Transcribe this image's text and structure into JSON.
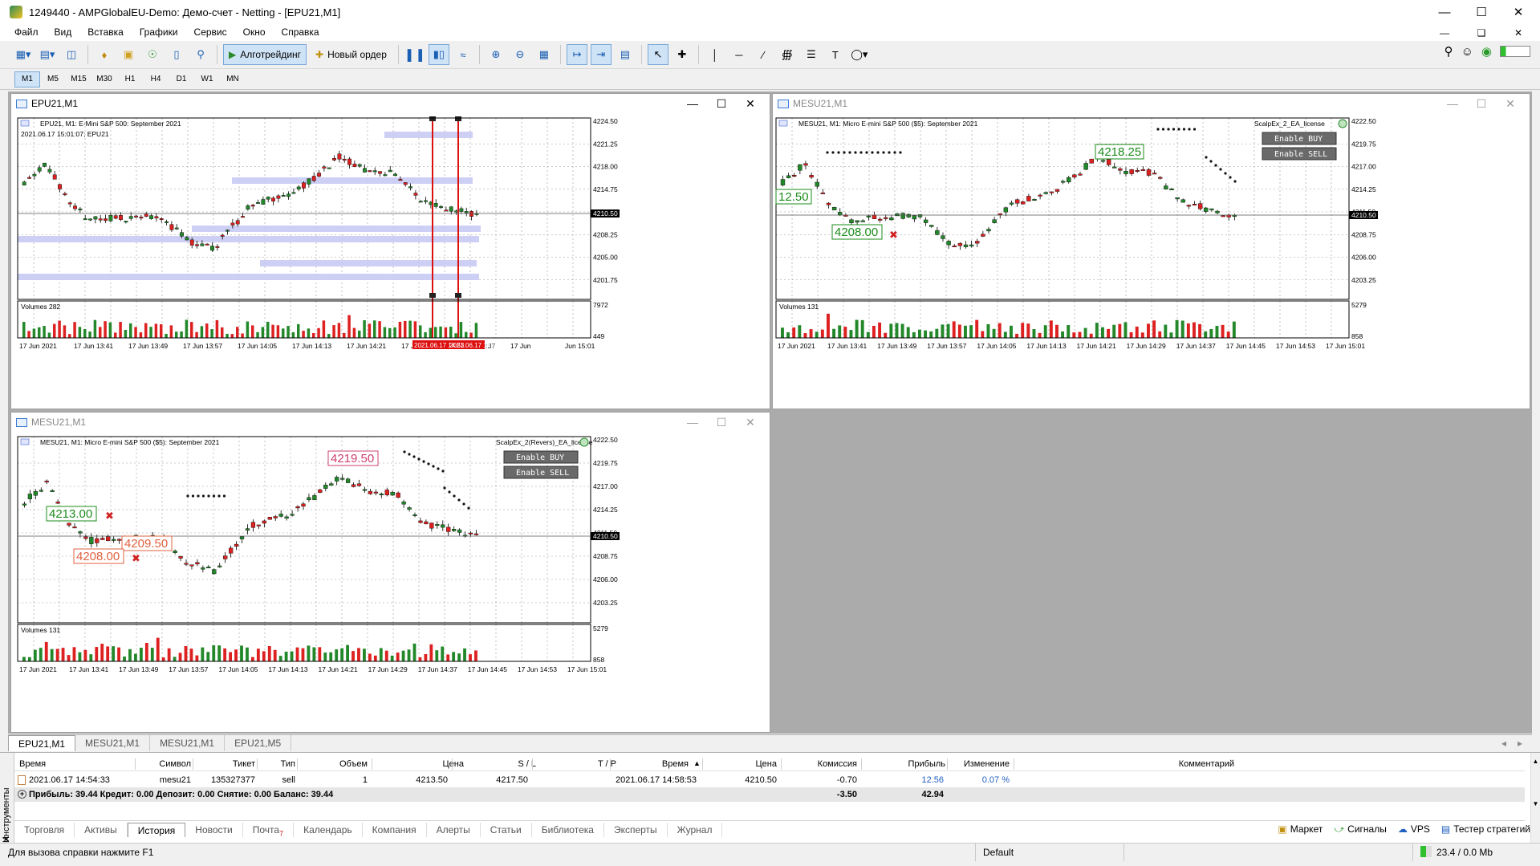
{
  "window": {
    "title": "1249440 - AMPGlobalEU-Demo: Демо-счет - Netting - [EPU21,M1]"
  },
  "menu": [
    "Файл",
    "Вид",
    "Вставка",
    "Графики",
    "Сервис",
    "Окно",
    "Справка"
  ],
  "toolbar": {
    "algo_label": "Алготрейдинг",
    "new_order_label": "Новый ордер"
  },
  "timeframes": [
    "M1",
    "M5",
    "M15",
    "M30",
    "H1",
    "H4",
    "D1",
    "W1",
    "MN"
  ],
  "charts": {
    "epu": {
      "window_title": "EPU21,M1",
      "header": "EPU21, M1:  E-Mini S&P 500: September 2021",
      "subheader": "2021.06.17 15:01:07; EPU21",
      "volumes_label": "Volumes 282",
      "price_ticks": [
        "4224.50",
        "4221.25",
        "4218.00",
        "4214.75",
        "4211.50",
        "4208.25",
        "4205.00",
        "4201.75"
      ],
      "current_price": "4210.50",
      "vol_ticks": [
        "7972",
        "449"
      ],
      "time_ticks": [
        "17 Jun 2021",
        "17 Jun 13:41",
        "17 Jun 13:49",
        "17 Jun 13:57",
        "17 Jun 14:05",
        "17 Jun 14:13",
        "17 Jun 14:21",
        "17 Jun 14:29",
        "17 Jun 14:37",
        "17 Jun",
        "Jun 15:01"
      ],
      "time_highlights": [
        "2021.06.17 14:53",
        "2021.06.17 14:58"
      ]
    },
    "mesu_top": {
      "window_title": "MESU21,M1",
      "header": "MESU21, M1:  Micro E-mini S&P 500 ($5): September 2021",
      "ea_label": "ScalpEx_2_EA_license",
      "btn_buy": "Enable  BUY",
      "btn_sell": "Enable  SELL",
      "volumes_label": "Volumes 131",
      "price_ticks": [
        "4222.50",
        "4219.75",
        "4217.00",
        "4214.25",
        "4211.50",
        "4208.75",
        "4206.00",
        "4203.25"
      ],
      "current_price": "4210.50",
      "vol_ticks": [
        "5279",
        "858"
      ],
      "time_ticks": [
        "17 Jun 2021",
        "17 Jun 13:41",
        "17 Jun 13:49",
        "17 Jun 13:57",
        "17 Jun 14:05",
        "17 Jun 14:13",
        "17 Jun 14:21",
        "17 Jun 14:29",
        "17 Jun 14:37",
        "17 Jun 14:45",
        "17 Jun 14:53",
        "17 Jun 15:01"
      ],
      "labels": {
        "a": "4218.25",
        "b": "12.50",
        "c": "4208.00"
      }
    },
    "mesu_bottom": {
      "window_title": "MESU21,M1",
      "header": "MESU21, M1:  Micro E-mini S&P 500 ($5): September 2021",
      "ea_label": "ScalpEx_2(Revers)_EA_license",
      "btn_buy": "Enable  BUY",
      "btn_sell": "Enable  SELL",
      "volumes_label": "Volumes 131",
      "price_ticks": [
        "4222.50",
        "4219.75",
        "4217.00",
        "4214.25",
        "4211.50",
        "4208.75",
        "4206.00",
        "4203.25"
      ],
      "current_price": "4210.50",
      "vol_ticks": [
        "5279",
        "858"
      ],
      "time_ticks": [
        "17 Jun 2021",
        "17 Jun 13:41",
        "17 Jun 13:49",
        "17 Jun 13:57",
        "17 Jun 14:05",
        "17 Jun 14:13",
        "17 Jun 14:21",
        "17 Jun 14:29",
        "17 Jun 14:37",
        "17 Jun 14:45",
        "17 Jun 14:53",
        "17 Jun 15:01"
      ],
      "labels": {
        "a": "4219.50",
        "b": "4213.00",
        "c": "4209.50",
        "d": "4208.00"
      }
    }
  },
  "chart_tabs": [
    "EPU21,M1",
    "MESU21,M1",
    "MESU21,M1",
    "EPU21,M5"
  ],
  "toolbox": {
    "vertical_label": "Инструменты",
    "headers": [
      "Время",
      "Символ",
      "Тикет",
      "Тип",
      "Объем",
      "Цена",
      "S / L",
      "T / P",
      "Время",
      "Цена",
      "Комиссия",
      "Прибыль",
      "Изменение",
      "Комментарий"
    ],
    "row": [
      "2021.06.17 14:54:33",
      "mesu21",
      "135327377",
      "sell",
      "1",
      "4213.50",
      "4217.50",
      "",
      "2021.06.17 14:58:53",
      "4210.50",
      "-0.70",
      "12.56",
      "0.07 %",
      ""
    ],
    "summary": {
      "text": "Прибыль: 39.44  Кредит: 0.00  Депозит: 0.00  Снятие: 0.00  Баланс: 39.44",
      "commission": "-3.50",
      "profit": "42.94"
    },
    "bottom_tabs": [
      "Торговля",
      "Активы",
      "История",
      "Новости",
      "Почта",
      "Календарь",
      "Компания",
      "Алерты",
      "Статьи",
      "Библиотека",
      "Эксперты",
      "Журнал"
    ],
    "mail_badge": "7",
    "right_tabs": [
      "Маркет",
      "Сигналы",
      "VPS",
      "Тестер стратегий"
    ]
  },
  "status": {
    "help": "Для вызова справки нажмите F1",
    "profile": "Default",
    "traffic": "23.4 / 0.0 Mb"
  },
  "colors": {
    "bull": "#22882a",
    "bear": "#dd2020",
    "band": "#c9caf3",
    "vline": "#dd1010",
    "label_green": "#1a8c1a",
    "label_red": "#e06040"
  }
}
